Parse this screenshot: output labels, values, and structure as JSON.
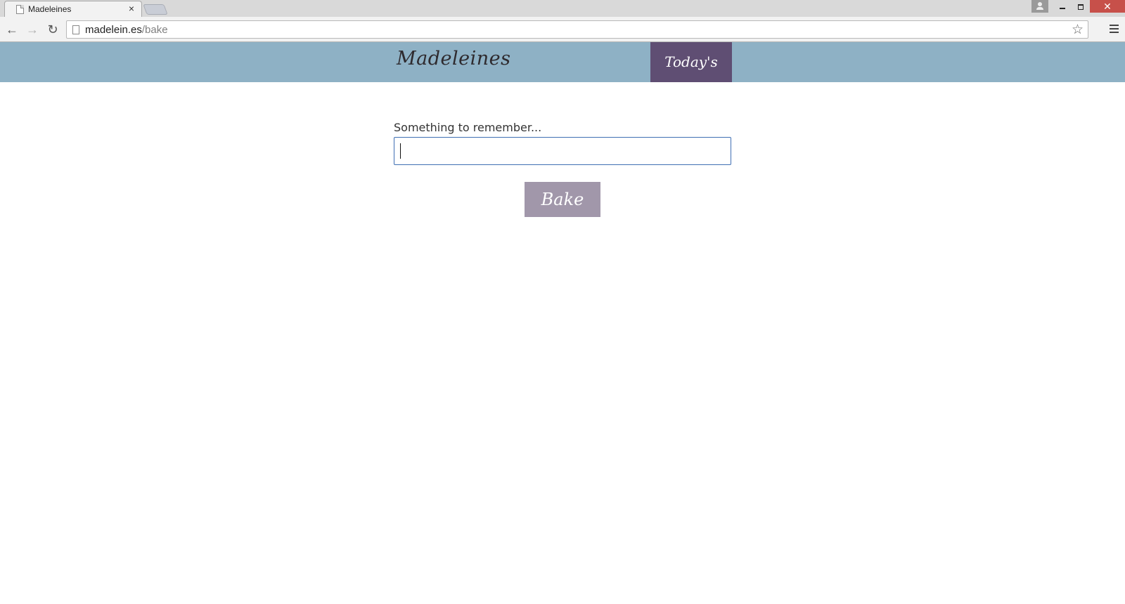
{
  "browser": {
    "tab_title": "Madeleines",
    "tab_close": "×",
    "url_host": "madelein.es",
    "url_path": "/bake",
    "window_close": "✕",
    "nav_back": "←",
    "nav_forward": "→",
    "nav_reload": "↻",
    "bookmark_star": "☆"
  },
  "header": {
    "logo": "Madeleines",
    "nav_button": "Today's",
    "background_color": "#8eb1c5",
    "nav_button_color": "#5f4e73"
  },
  "form": {
    "label": "Something to remember...",
    "input_value": "",
    "submit_label": "Bake",
    "submit_color": "#a197aa"
  }
}
